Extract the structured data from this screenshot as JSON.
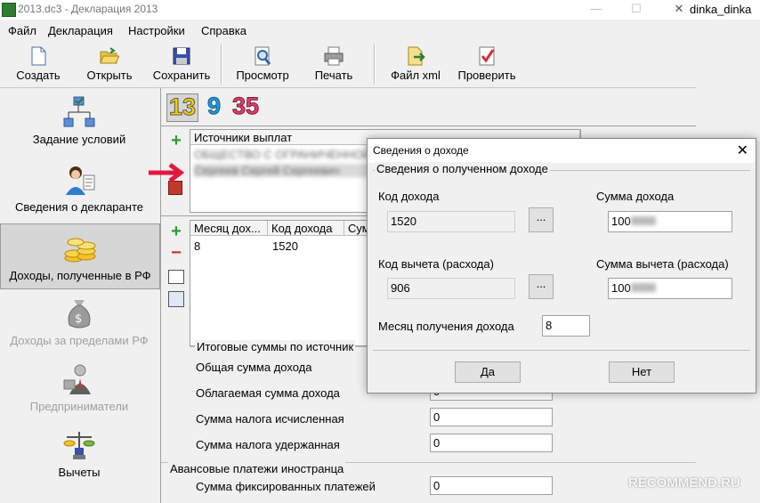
{
  "window": {
    "title": "2013.dc3 - Декларация 2013",
    "user_tag": "dinka_dinka",
    "minimize": "—",
    "maximize": "☐",
    "close": "✕"
  },
  "menu": [
    "Файл",
    "Декларация",
    "Настройки",
    "Справка"
  ],
  "toolbar": {
    "create": "Создать",
    "open": "Открыть",
    "save": "Сохранить",
    "preview": "Просмотр",
    "print": "Печать",
    "xml": "Файл xml",
    "check": "Проверить"
  },
  "rates": [
    "13",
    "9",
    "35"
  ],
  "sidebar": [
    {
      "label": "Задание условий",
      "icon": "tree-icon"
    },
    {
      "label": "Сведения о декларанте",
      "icon": "person-icon"
    },
    {
      "label": "Доходы, полученные в РФ",
      "icon": "coins-icon"
    },
    {
      "label": "Доходы за пределами РФ",
      "icon": "money-bag-icon"
    },
    {
      "label": "Предприниматели",
      "icon": "businessman-icon"
    },
    {
      "label": "Вычеты",
      "icon": "scales-icon"
    }
  ],
  "sources": {
    "header": "Источники выплат",
    "row1": "ОБЩЕСТВО С ОГРАНИЧЕННОЙ",
    "row2": "Сергеев Сергей Сергеевич"
  },
  "income_table": {
    "headers": [
      "Месяц дох...",
      "Код дохода",
      "Сум"
    ],
    "rows": [
      {
        "month": "8",
        "code": "1520"
      }
    ]
  },
  "totals": {
    "group_title": "Итоговые суммы по источник",
    "rows": [
      {
        "label": "Общая сумма дохода",
        "value": ""
      },
      {
        "label": "Облагаемая сумма дохода",
        "value": "0"
      },
      {
        "label": "Сумма налога исчисленная",
        "value": "0"
      },
      {
        "label": "Сумма налога удержанная",
        "value": "0"
      }
    ]
  },
  "advance": {
    "group_title": "Авансовые платежи иностранца",
    "label": "Сумма фиксированных платежей",
    "value": "0"
  },
  "dialog": {
    "title": "Сведения о доходе",
    "group_title": "Сведения о полученном доходе",
    "income_code_label": "Код дохода",
    "income_code": "1520",
    "income_sum_label": "Сумма дохода",
    "income_sum": "100",
    "deduction_code_label": "Код вычета (расхода)",
    "deduction_code": "906",
    "deduction_sum_label": "Сумма вычета (расхода)",
    "deduction_sum": "100",
    "month_label": "Месяц получения дохода",
    "month": "8",
    "dots": "...",
    "ok": "Да",
    "cancel": "Нет",
    "close": "✕"
  },
  "watermark": "RECOMMEND.RU"
}
